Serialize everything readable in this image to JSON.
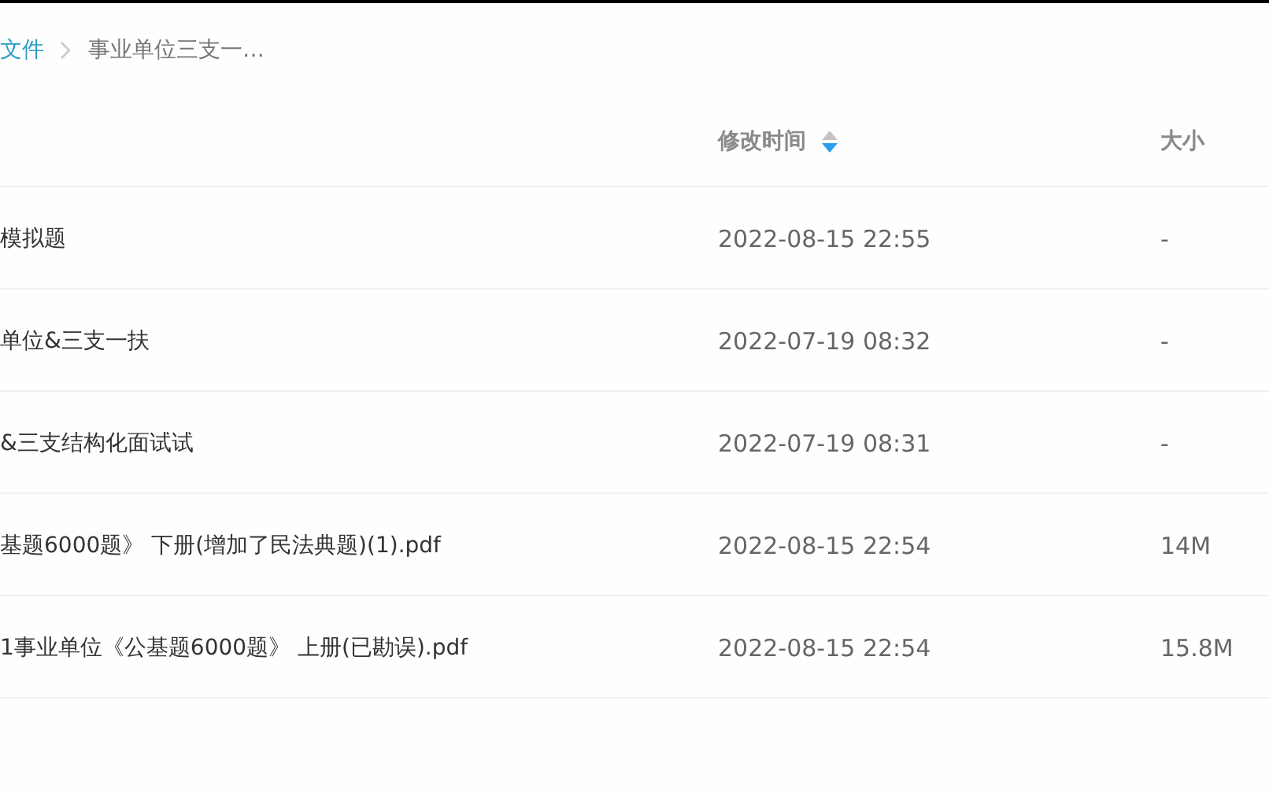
{
  "breadcrumb": [
    {
      "label": "文件",
      "current": false
    },
    {
      "label": "事业单位三支一…",
      "current": true
    }
  ],
  "table": {
    "columns": [
      {
        "label": "修改时间",
        "sorted_descending": true
      },
      {
        "label": "大小"
      }
    ],
    "rows": [
      {
        "name": "模拟题",
        "modified": "2022-08-15 22:55",
        "size": "-"
      },
      {
        "name": "单位&三支一扶",
        "modified": "2022-07-19 08:32",
        "size": "-"
      },
      {
        "name": "&三支结构化面试试",
        "modified": "2022-07-19 08:31",
        "size": "-"
      },
      {
        "name": "基题6000题》 下册(增加了民法典题)(1).pdf",
        "modified": "2022-08-15 22:54",
        "size": "14M"
      },
      {
        "name": "1事业单位《公基题6000题》 上册(已勘误).pdf",
        "modified": "2022-08-15 22:54",
        "size": "15.8M"
      }
    ]
  }
}
